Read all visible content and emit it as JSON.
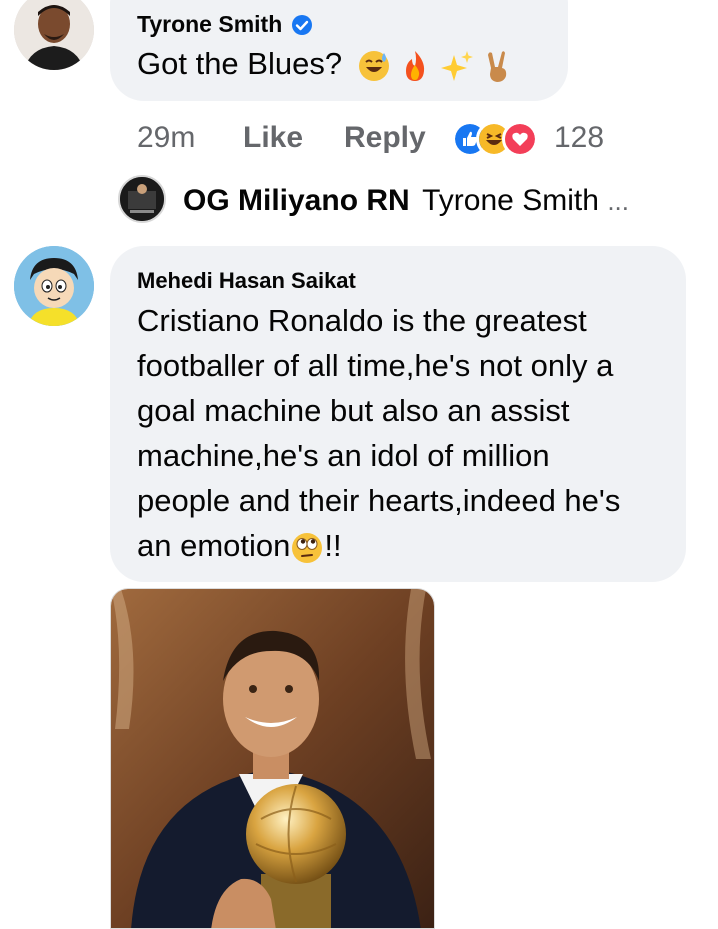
{
  "comment1": {
    "author": "Tyrone Smith",
    "text": "Got the Blues?",
    "time": "29m",
    "like_label": "Like",
    "reply_label": "Reply",
    "reaction_count": "128",
    "emojis": [
      "grinning-sweat",
      "fire",
      "sparkles",
      "victory-hand"
    ]
  },
  "reply_preview": {
    "author": "OG Miliyano RN",
    "text": "Tyrone Smith",
    "ellipsis": "..."
  },
  "comment2": {
    "author": "Mehedi Hasan Saikat",
    "lines": [
      "Cristiano Ronaldo is the greatest",
      "footballer of all time,he's not only a",
      "goal machine but also an assist",
      "machine,he's an idol of million",
      "people and their hearts,indeed he's",
      "an emotion"
    ],
    "suffix": "!!"
  },
  "colors": {
    "bubble": "#f0f2f5",
    "meta": "#65676b",
    "like_blue": "#1877f2",
    "love_red": "#f33e58",
    "haha_yellow": "#f7b928"
  }
}
